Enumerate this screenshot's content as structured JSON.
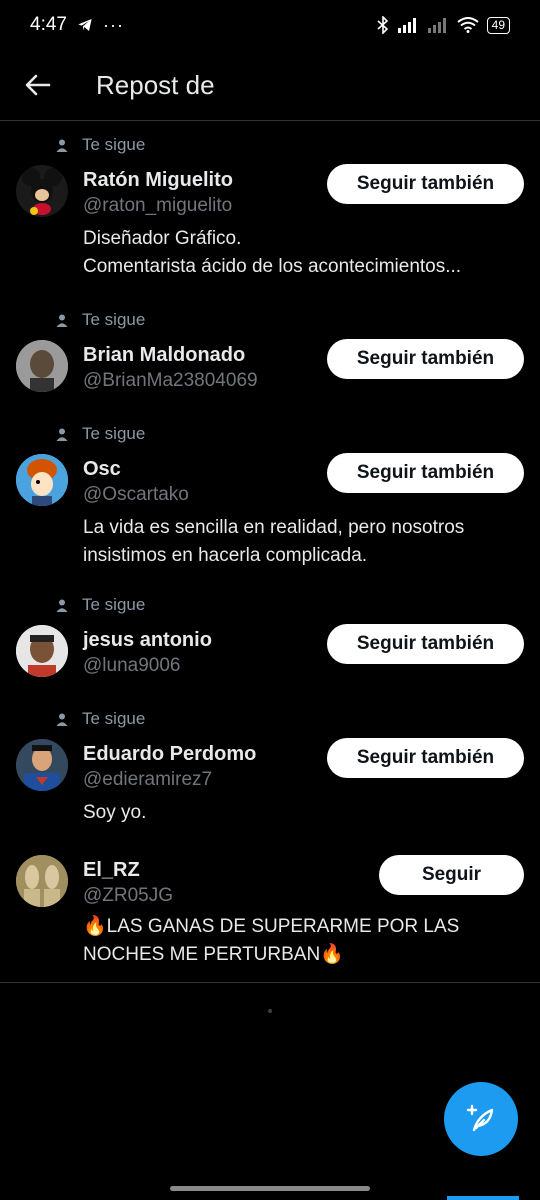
{
  "status": {
    "time": "4:47",
    "battery": "49"
  },
  "header": {
    "title": "Repost de"
  },
  "users": [
    {
      "follows_label": "Te sigue",
      "name": "Ratón Miguelito",
      "handle": "@raton_miguelito",
      "bio_lines": [
        "Diseñador Gráfico.",
        "Comentarista ácido de los acontecimientos..."
      ],
      "button": "Seguir también"
    },
    {
      "follows_label": "Te sigue",
      "name": "Brian Maldonado",
      "handle": "@BrianMa23804069",
      "bio_lines": [],
      "button": "Seguir también"
    },
    {
      "follows_label": "Te sigue",
      "name": "Osc",
      "handle": "@Oscartako",
      "bio_lines": [
        "La vida es sencilla en realidad, pero nosotros",
        "insistimos en hacerla complicada."
      ],
      "button": "Seguir también"
    },
    {
      "follows_label": "Te sigue",
      "name": "jesus antonio",
      "handle": "@luna9006",
      "bio_lines": [],
      "button": "Seguir también"
    },
    {
      "follows_label": "Te sigue",
      "name": "Eduardo Perdomo",
      "handle": "@edieramirez7",
      "bio_lines": [
        "Soy yo."
      ],
      "button": "Seguir también"
    },
    {
      "follows_label": "",
      "name": "El_RZ",
      "handle": "@ZR05JG",
      "bio_lines": [
        "🔥LAS GANAS DE SUPERARME POR LAS",
        "NOCHES ME PERTURBAN🔥"
      ],
      "button": "Seguir"
    }
  ],
  "colors": {
    "accent": "#1d9bf0",
    "background": "#000000",
    "muted": "#71767b"
  },
  "icons": [
    "telegram-icon",
    "more-dots-icon",
    "bluetooth-icon",
    "signal-icon",
    "wifi-icon",
    "battery-icon",
    "back-arrow-icon",
    "person-icon",
    "compose-icon"
  ]
}
